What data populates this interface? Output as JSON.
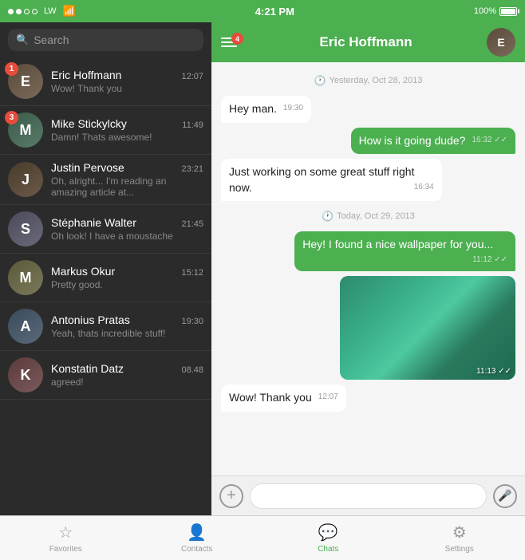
{
  "statusBar": {
    "carrier": "LW",
    "time": "4:21 PM",
    "battery": "100%"
  },
  "search": {
    "placeholder": "Search"
  },
  "chatList": [
    {
      "id": 1,
      "name": "Eric Hoffmann",
      "time": "12:07",
      "preview": "Wow! Thank you",
      "badge": 1,
      "avatarInitial": "E",
      "avatarClass": "av-eric"
    },
    {
      "id": 2,
      "name": "Mike Stickylcky",
      "time": "11:49",
      "preview": "Damn! Thats awesome!",
      "badge": 3,
      "avatarInitial": "M",
      "avatarClass": "av-mike"
    },
    {
      "id": 3,
      "name": "Justin Pervose",
      "time": "23:21",
      "preview": "Oh, alright... I'm reading an amazing article at...",
      "badge": 0,
      "avatarInitial": "J",
      "avatarClass": "av-justin"
    },
    {
      "id": 4,
      "name": "Stéphanie Walter",
      "time": "21:45",
      "preview": "Oh look! I have a moustache",
      "badge": 0,
      "avatarInitial": "S",
      "avatarClass": "av-steph"
    },
    {
      "id": 5,
      "name": "Markus Okur",
      "time": "15:12",
      "preview": "Pretty good.",
      "badge": 0,
      "avatarInitial": "M",
      "avatarClass": "av-markus"
    },
    {
      "id": 6,
      "name": "Antonius Pratas",
      "time": "19:30",
      "preview": "Yeah, thats incredible stuff!",
      "badge": 0,
      "avatarInitial": "A",
      "avatarClass": "av-ant"
    },
    {
      "id": 7,
      "name": "Konstatin Datz",
      "time": "08.48",
      "preview": "agreed!",
      "badge": 0,
      "avatarInitial": "K",
      "avatarClass": "av-kon"
    }
  ],
  "chatHeader": {
    "name": "Eric Hoffmann",
    "notificationCount": "4"
  },
  "messages": [
    {
      "type": "date",
      "text": "Yesterday, Oct 28, 2013"
    },
    {
      "type": "incoming",
      "text": "Hey man.",
      "time": "19:30"
    },
    {
      "type": "outgoing",
      "text": "How is it going dude?",
      "time": "16:32",
      "ticks": "✓✓"
    },
    {
      "type": "incoming",
      "text": "Just working on some great stuff right now.",
      "time": "16:34"
    },
    {
      "type": "date",
      "text": "Today, Oct 29, 2013"
    },
    {
      "type": "outgoing",
      "text": "Hey! I found a nice wallpaper for you...",
      "time": "11:12",
      "ticks": "✓✓"
    },
    {
      "type": "image",
      "time": "11:13",
      "ticks": "✓✓"
    },
    {
      "type": "incoming",
      "text": "Wow! Thank you",
      "time": "12:07"
    }
  ],
  "inputBar": {
    "placeholder": ""
  },
  "tabs": [
    {
      "id": "favorites",
      "label": "Favorites",
      "icon": "☆",
      "active": false
    },
    {
      "id": "contacts",
      "label": "Contacts",
      "icon": "👤",
      "active": false
    },
    {
      "id": "chats",
      "label": "Chats",
      "icon": "💬",
      "active": true
    },
    {
      "id": "settings",
      "label": "Settings",
      "icon": "⚙",
      "active": false
    }
  ]
}
